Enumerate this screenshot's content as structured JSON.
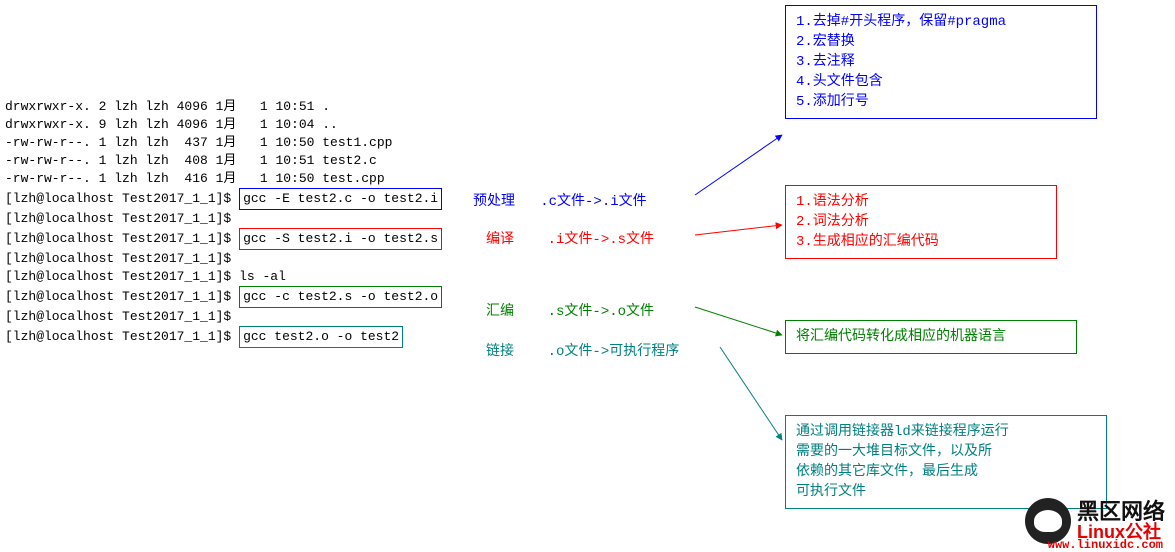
{
  "terminal": {
    "listing": [
      "drwxrwxr-x. 2 lzh lzh 4096 1月   1 10:51 .",
      "drwxrwxr-x. 9 lzh lzh 4096 1月   1 10:04 ..",
      "-rw-rw-r--. 1 lzh lzh  437 1月   1 10:50 test1.cpp",
      "-rw-rw-r--. 1 lzh lzh  408 1月   1 10:51 test2.c",
      "-rw-rw-r--. 1 lzh lzh  416 1月   1 10:50 test.cpp"
    ],
    "prompt": "[lzh@localhost Test2017_1_1]$",
    "cmds": {
      "preprocess": "gcc -E test2.c -o test2.i",
      "compile": "gcc -S test2.i -o test2.s",
      "ls": "ls -al",
      "assemble": "gcc -c test2.s -o test2.o",
      "link": "gcc test2.o -o test2"
    }
  },
  "stages": {
    "preprocess": {
      "title": "预处理",
      "conv": ".c文件->.i文件"
    },
    "compile": {
      "title": "编译",
      "conv": ".i文件->.s文件"
    },
    "assemble": {
      "title": "汇编",
      "conv": ".s文件->.o文件"
    },
    "link": {
      "title": "链接",
      "conv": ".o文件->可执行程序"
    }
  },
  "notes": {
    "preprocess": [
      "1.去掉#开头程序，保留#pragma",
      "2.宏替换",
      "3.去注释",
      "4.头文件包含",
      "5.添加行号"
    ],
    "compile": [
      "1.语法分析",
      "2.词法分析",
      "3.生成相应的汇编代码"
    ],
    "assemble": "将汇编代码转化成相应的机器语言",
    "link": [
      "通过调用链接器ld来链接程序运行",
      "需要的一大堆目标文件，以及所",
      "依赖的其它库文件，最后生成",
      "可执行文件"
    ]
  },
  "watermark": {
    "line1": "黑区网络",
    "line2": "Linux公社",
    "url": "www.linuxidc.com"
  }
}
